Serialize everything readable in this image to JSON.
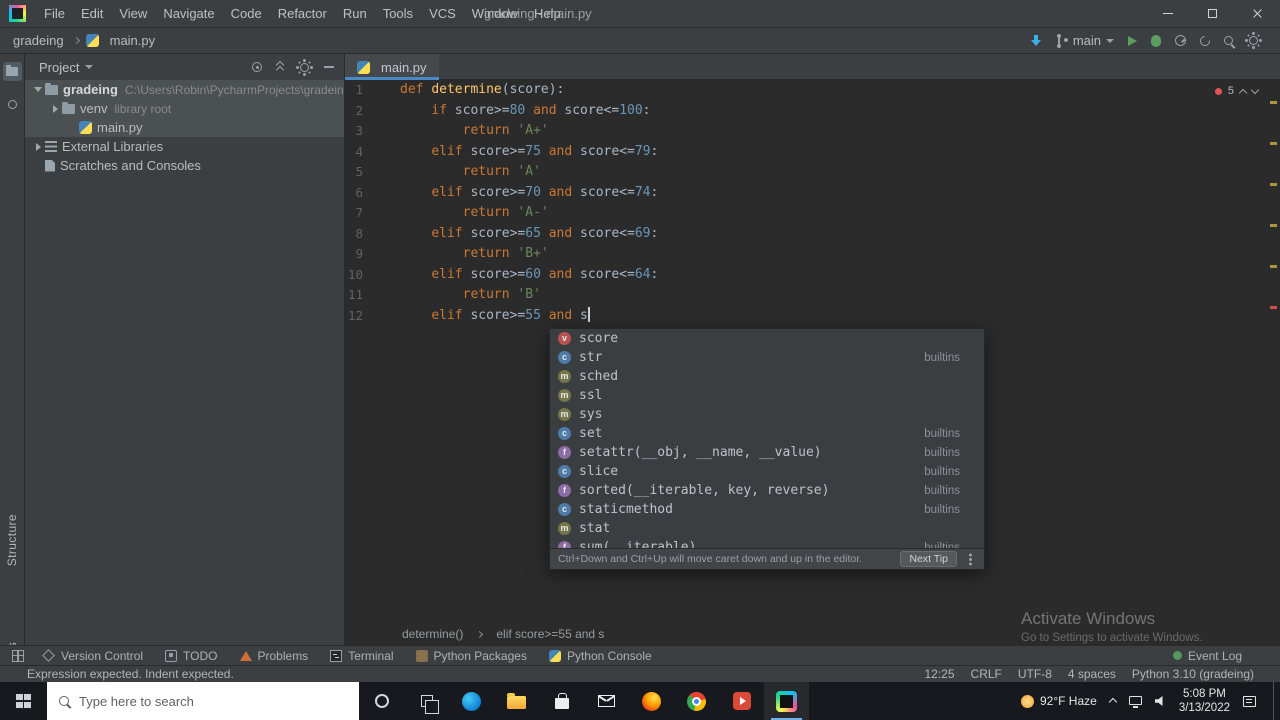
{
  "window": {
    "title": "gradeing - main.py",
    "controls": [
      "minimize",
      "maximize",
      "close"
    ]
  },
  "menu_bar": {
    "items": [
      "File",
      "Edit",
      "View",
      "Navigate",
      "Code",
      "Refactor",
      "Run",
      "Tools",
      "VCS",
      "Window",
      "Help"
    ]
  },
  "nav_bar": {
    "project": "gradeing",
    "file": "main.py",
    "branch": "main",
    "actions_left": [
      "update-project"
    ],
    "actions_right": [
      "run",
      "debug",
      "profiler",
      "restart",
      "search-everywhere",
      "settings"
    ]
  },
  "left_stripe": {
    "top_icons": [
      {
        "name": "project-folder",
        "active": true
      },
      {
        "name": "commit"
      }
    ],
    "labels": [
      "Structure",
      "Bookmarks"
    ]
  },
  "project_panel": {
    "header": "Project",
    "header_actions": [
      "locate-file",
      "collapse-all",
      "settings",
      "hide"
    ],
    "items": [
      {
        "label": "gradeing",
        "hint": "C:\\Users\\Robin\\PycharmProjects\\gradeing",
        "indent": 0,
        "icon": "folder",
        "arrow": "down",
        "highlight": true,
        "bold": true
      },
      {
        "label": "venv",
        "hint": "library root",
        "indent": 1,
        "icon": "folder",
        "arrow": "right",
        "highlight": true
      },
      {
        "label": "main.py",
        "indent": 2,
        "icon": "python",
        "highlight": true
      },
      {
        "label": "External Libraries",
        "indent": 0,
        "icon": "libraries",
        "arrow": "right"
      },
      {
        "label": "Scratches and Consoles",
        "indent": 0,
        "icon": "scratches"
      }
    ]
  },
  "editor": {
    "tab": "main.py",
    "inspections": {
      "warnings": "5"
    },
    "breadcrumb": [
      "determine()",
      "elif score>=55 and s"
    ],
    "lines": [
      {
        "num": "1",
        "tokens": [
          [
            "kw",
            "def "
          ],
          [
            "fn",
            "determine"
          ],
          [
            "pl",
            "(score):"
          ]
        ]
      },
      {
        "num": "2",
        "tokens": [
          [
            "pl",
            "    "
          ],
          [
            "kw",
            "if "
          ],
          [
            "pl",
            "score>="
          ],
          [
            "num",
            "80"
          ],
          [
            "kw",
            " and "
          ],
          [
            "pl",
            "score<="
          ],
          [
            "num",
            "100"
          ],
          [
            "pl",
            ":"
          ]
        ]
      },
      {
        "num": "3",
        "tokens": [
          [
            "pl",
            "        "
          ],
          [
            "kw",
            "return "
          ],
          [
            "str",
            "'A+'"
          ]
        ]
      },
      {
        "num": "4",
        "tokens": [
          [
            "pl",
            "    "
          ],
          [
            "kw",
            "elif "
          ],
          [
            "pl",
            "score>="
          ],
          [
            "num",
            "75"
          ],
          [
            "kw",
            " and "
          ],
          [
            "pl",
            "score<="
          ],
          [
            "num",
            "79"
          ],
          [
            "pl",
            ":"
          ]
        ]
      },
      {
        "num": "5",
        "tokens": [
          [
            "pl",
            "        "
          ],
          [
            "kw",
            "return "
          ],
          [
            "str",
            "'A'"
          ]
        ]
      },
      {
        "num": "6",
        "tokens": [
          [
            "pl",
            "    "
          ],
          [
            "kw",
            "elif "
          ],
          [
            "pl",
            "score>="
          ],
          [
            "num",
            "70"
          ],
          [
            "kw",
            " and "
          ],
          [
            "pl",
            "score<="
          ],
          [
            "num",
            "74"
          ],
          [
            "pl",
            ":"
          ]
        ]
      },
      {
        "num": "7",
        "tokens": [
          [
            "pl",
            "        "
          ],
          [
            "kw",
            "return "
          ],
          [
            "str",
            "'A-'"
          ]
        ]
      },
      {
        "num": "8",
        "tokens": [
          [
            "pl",
            "    "
          ],
          [
            "kw",
            "elif "
          ],
          [
            "pl",
            "score>="
          ],
          [
            "num",
            "65"
          ],
          [
            "kw",
            " and "
          ],
          [
            "pl",
            "score<="
          ],
          [
            "num",
            "69"
          ],
          [
            "pl",
            ":"
          ]
        ]
      },
      {
        "num": "9",
        "tokens": [
          [
            "pl",
            "        "
          ],
          [
            "kw",
            "return "
          ],
          [
            "str",
            "'B+'"
          ]
        ]
      },
      {
        "num": "10",
        "tokens": [
          [
            "pl",
            "    "
          ],
          [
            "kw",
            "elif "
          ],
          [
            "pl",
            "score>="
          ],
          [
            "num",
            "60"
          ],
          [
            "kw",
            " and "
          ],
          [
            "pl",
            "score<="
          ],
          [
            "num",
            "64"
          ],
          [
            "pl",
            ":"
          ]
        ]
      },
      {
        "num": "11",
        "tokens": [
          [
            "pl",
            "        "
          ],
          [
            "kw",
            "return "
          ],
          [
            "str",
            "'B'"
          ]
        ]
      },
      {
        "num": "12",
        "tokens": [
          [
            "pl",
            "    "
          ],
          [
            "kw",
            "elif "
          ],
          [
            "pl",
            "score>="
          ],
          [
            "num",
            "55"
          ],
          [
            "kw",
            " and "
          ],
          [
            "pl",
            "s"
          ]
        ],
        "caret": true
      }
    ]
  },
  "autocomplete": {
    "rows": [
      {
        "name": "score",
        "kind": "v"
      },
      {
        "name": "str",
        "kind": "c",
        "tail": "builtins"
      },
      {
        "name": "sched",
        "kind": "m"
      },
      {
        "name": "ssl",
        "kind": "m"
      },
      {
        "name": "sys",
        "kind": "m"
      },
      {
        "name": "set",
        "kind": "c",
        "tail": "builtins"
      },
      {
        "name": "setattr(__obj, __name, __value)",
        "kind": "f",
        "tail": "builtins"
      },
      {
        "name": "slice",
        "kind": "c",
        "tail": "builtins"
      },
      {
        "name": "sorted(__iterable, key, reverse)",
        "kind": "f",
        "tail": "builtins"
      },
      {
        "name": "staticmethod",
        "kind": "c",
        "tail": "builtins"
      },
      {
        "name": "stat",
        "kind": "m"
      },
      {
        "name": "sum(__iterable)",
        "kind": "f",
        "tail": "builtins"
      }
    ],
    "hint": "Ctrl+Down and Ctrl+Up will move caret down and up in the editor.",
    "next_tip": "Next Tip"
  },
  "tool_windows": {
    "items": [
      {
        "label": "Version Control",
        "icon": "vcs"
      },
      {
        "label": "TODO",
        "icon": "todo"
      },
      {
        "label": "Problems",
        "icon": "problems"
      },
      {
        "label": "Terminal",
        "icon": "terminal"
      },
      {
        "label": "Python Packages",
        "icon": "packages"
      },
      {
        "label": "Python Console",
        "icon": "python"
      }
    ],
    "event_log": "Event Log"
  },
  "status_bar": {
    "message": "Expression expected. Indent expected.",
    "items": [
      "12:25",
      "CRLF",
      "UTF-8",
      "4 spaces",
      "Python 3.10 (gradeing)"
    ]
  },
  "watermark": {
    "line1": "Activate Windows",
    "line2": "Go to Settings to activate Windows."
  },
  "taskbar": {
    "search_placeholder": "Type here to search",
    "apps": [
      "cortana",
      "task-view",
      "edge",
      "file-explorer",
      "store",
      "mail",
      "firefox",
      "chrome",
      "media-player",
      "pycharm"
    ],
    "active_app": "pycharm",
    "tray": {
      "weather": "92°F Haze",
      "icons": [
        "network",
        "volume"
      ],
      "time": "5:08 PM",
      "date": "3/13/2022"
    }
  }
}
